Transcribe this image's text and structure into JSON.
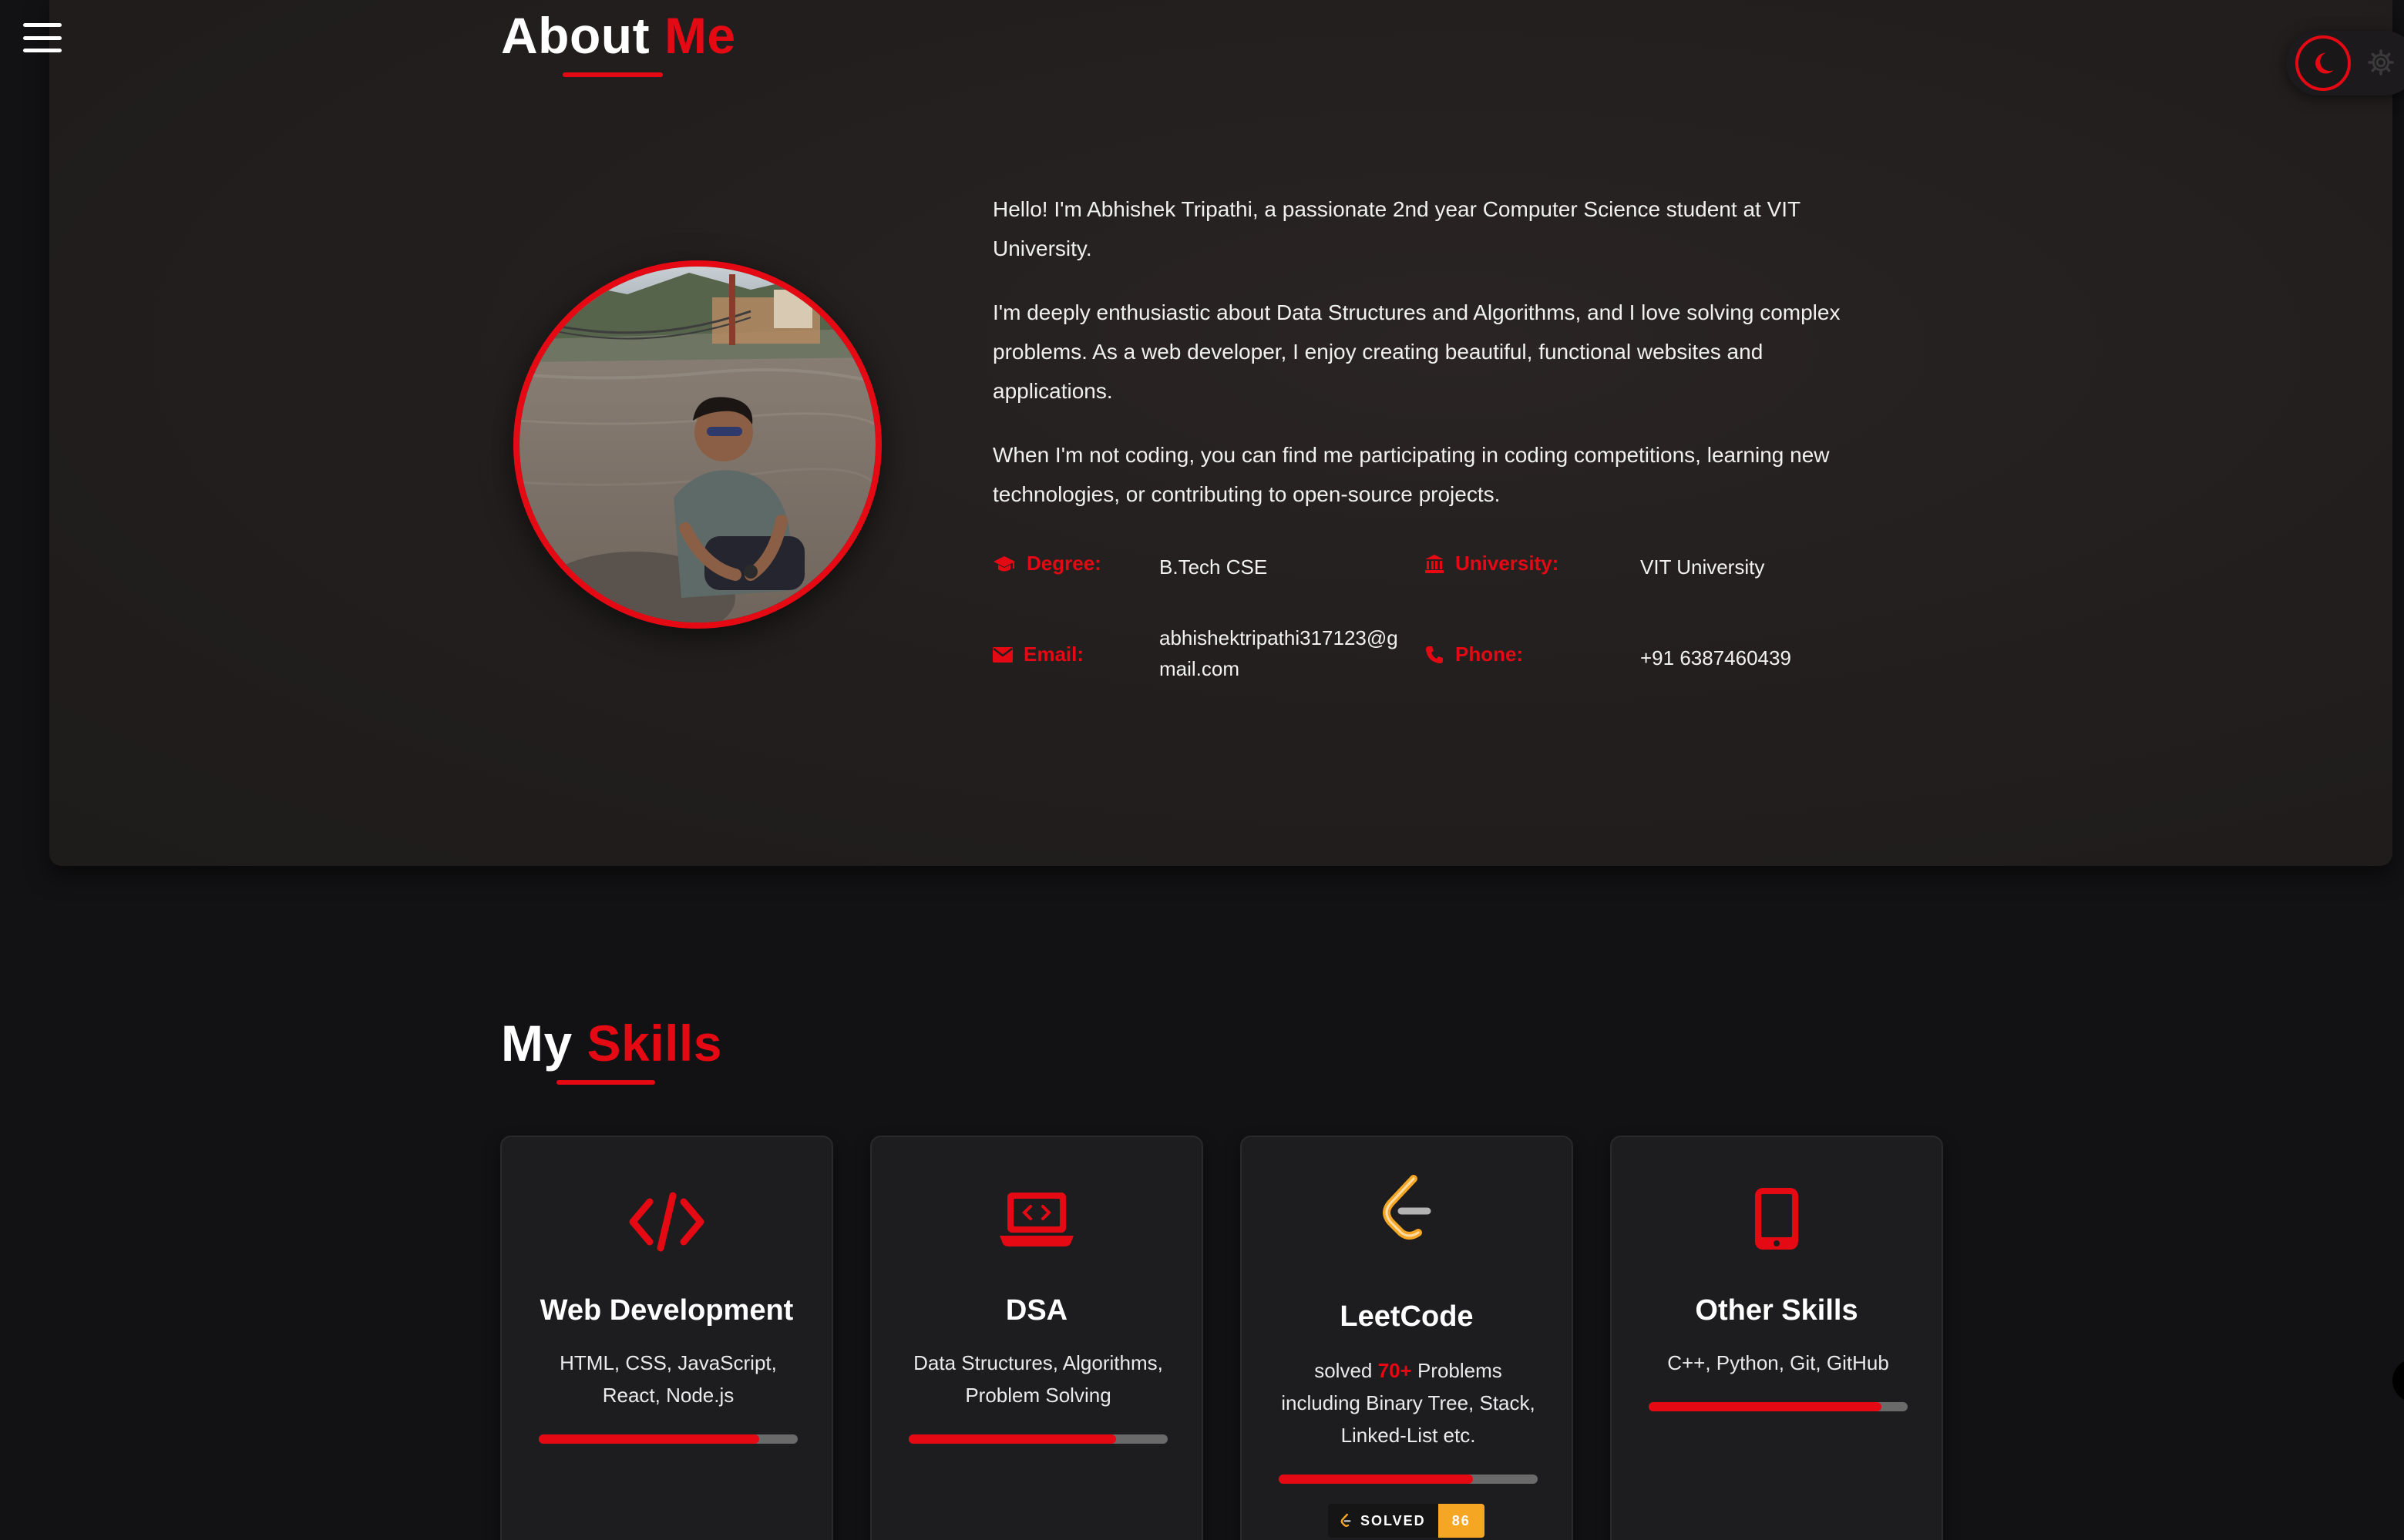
{
  "about": {
    "title_main": "About",
    "title_accent": "Me",
    "paragraphs": [
      "Hello! I'm Abhishek Tripathi, a passionate 2nd year Computer Science student at VIT University.",
      "I'm deeply enthusiastic about Data Structures and Algorithms, and I love solving complex problems. As a web developer, I enjoy creating beautiful, functional websites and applications.",
      "When I'm not coding, you can find me participating in coding competitions, learning new technologies, or contributing to open-source projects."
    ],
    "info": {
      "degree_label": "Degree:",
      "degree_value": "B.Tech CSE",
      "university_label": "University:",
      "university_value": "VIT University",
      "email_label": "Email:",
      "email_value_line1": "abhishektripathi317123@g",
      "email_value_line2": "mail.com",
      "phone_label": "Phone:",
      "phone_value": "+91 6387460439"
    }
  },
  "skills": {
    "title_main": "My",
    "title_accent": "Skills",
    "cards": [
      {
        "title": "Web Development",
        "desc": "HTML, CSS, JavaScript, React, Node.js",
        "level": 0.85,
        "icon": "code-icon"
      },
      {
        "title": "DSA",
        "desc": "Data Structures, Algorithms, Problem Solving",
        "level": 0.8,
        "icon": "laptop-code-icon"
      },
      {
        "title": "LeetCode",
        "desc_before": "solved ",
        "desc_highlight": "70+",
        "desc_after": " Problems including Binary Tree, Stack, Linked-List etc.",
        "level": 0.75,
        "icon": "leetcode-icon",
        "badge_label": "SOLVED",
        "badge_value": "86"
      },
      {
        "title": "Other Skills",
        "desc": "C++, Python, Git, GitHub",
        "level": 0.9,
        "icon": "mobile-icon"
      }
    ]
  },
  "colors": {
    "accent": "#e50914",
    "background": "#121113",
    "card": "#1d1c1e",
    "leetcode_badge": "#f5a623"
  },
  "icons": [
    "hamburger-menu-icon",
    "moon-icon",
    "gear-icon",
    "graduation-cap-icon",
    "university-icon",
    "envelope-icon",
    "phone-icon"
  ]
}
